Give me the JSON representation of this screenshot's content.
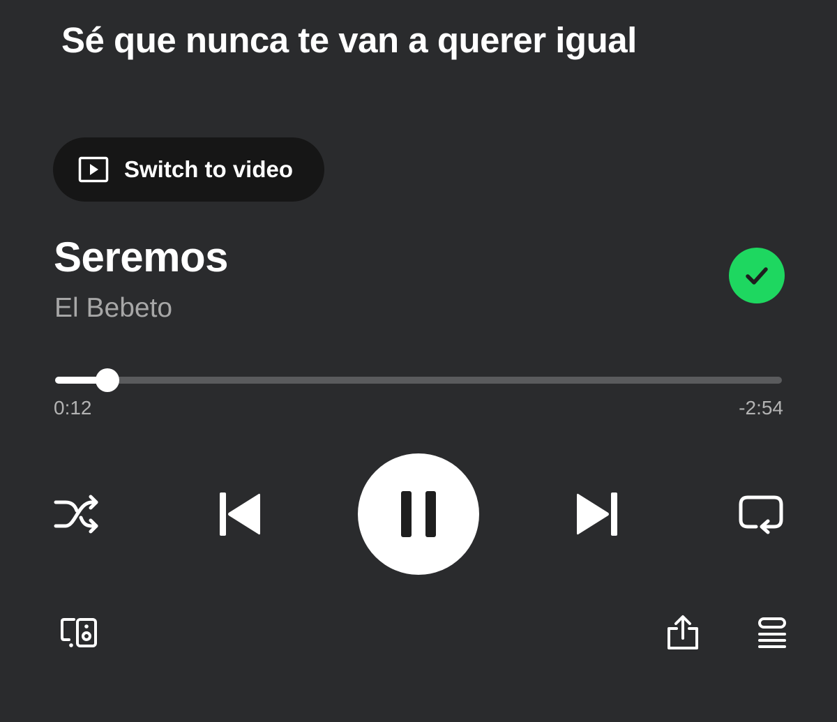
{
  "lyric": {
    "line": "Sé que nunca te van a querer igual"
  },
  "video_toggle": {
    "label": "Switch to video",
    "icon": "play-square-icon"
  },
  "track": {
    "title": "Seremos",
    "artist": "El Bebeto",
    "saved": true,
    "saved_icon": "checkmark-circle-icon",
    "saved_color": "#1ed760"
  },
  "playback": {
    "elapsed": "0:12",
    "remaining": "-2:54",
    "progress_fraction": 0.072
  },
  "controls": {
    "shuffle_icon": "shuffle-icon",
    "previous_icon": "skip-previous-icon",
    "play_state": "playing",
    "pause_icon": "pause-icon",
    "next_icon": "skip-next-icon",
    "repeat_icon": "repeat-icon"
  },
  "footer": {
    "devices_icon": "connect-device-icon",
    "share_icon": "share-icon",
    "queue_icon": "queue-icon"
  },
  "colors": {
    "background": "#2a2b2d",
    "pill_background": "#161616",
    "accent": "#1ed760",
    "secondary_text": "#a7a7a7"
  }
}
